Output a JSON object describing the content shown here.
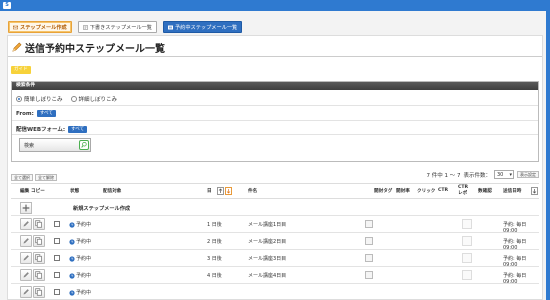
{
  "topbar": {
    "logo": "S"
  },
  "tabs": [
    {
      "label": "ステップメール作成"
    },
    {
      "label": "下書きステップメール一覧"
    },
    {
      "label": "予約中ステップメール一覧"
    }
  ],
  "page": {
    "title": "送信予約中ステップメール一覧",
    "guide_label": "ガイド"
  },
  "search": {
    "header": "検索条件",
    "radio_simple": "簡単しぼりこみ",
    "radio_detail": "詳細しぼりこみ",
    "from_label": "From:",
    "from_value": "すべて",
    "form_label": "配信WEBフォーム:",
    "form_value": "すべて",
    "search_button": "検索"
  },
  "list": {
    "select_all": "全て選択",
    "deselect_all": "全て解除",
    "count_text": "7 件中 1 ～ 7",
    "per_page_label": "表示件数：",
    "per_page_value": "30",
    "settings_button": "表示設定"
  },
  "table": {
    "headers": {
      "edit": "編集",
      "copy": "コピー",
      "status": "状態",
      "target": "配信対象",
      "day": "日",
      "name": "件名",
      "open_tag": "開封タグ",
      "open_rate": "開封率",
      "click": "クリック",
      "ctr": "CTR",
      "ctr_rate": "CTR\nレポ",
      "count": "数確認",
      "schedule": "送信日時"
    },
    "new_row_label": "新規ステップメール作成",
    "rows": [
      {
        "status": "予約中",
        "day": "1 日後",
        "name": "メール講座1日目",
        "schedule": "予約: 毎日 09:00"
      },
      {
        "status": "予約中",
        "day": "2 日後",
        "name": "メール講座2日目",
        "schedule": "予約: 毎日 09:00"
      },
      {
        "status": "予約中",
        "day": "3 日後",
        "name": "メール講座3日目",
        "schedule": "予約: 毎日 09:00"
      },
      {
        "status": "予約中",
        "day": "4 日後",
        "name": "メール講座4日目",
        "schedule": "予約: 毎日 09:00"
      },
      {
        "status": "予約中",
        "day": "",
        "name": "",
        "schedule": ""
      }
    ]
  }
}
